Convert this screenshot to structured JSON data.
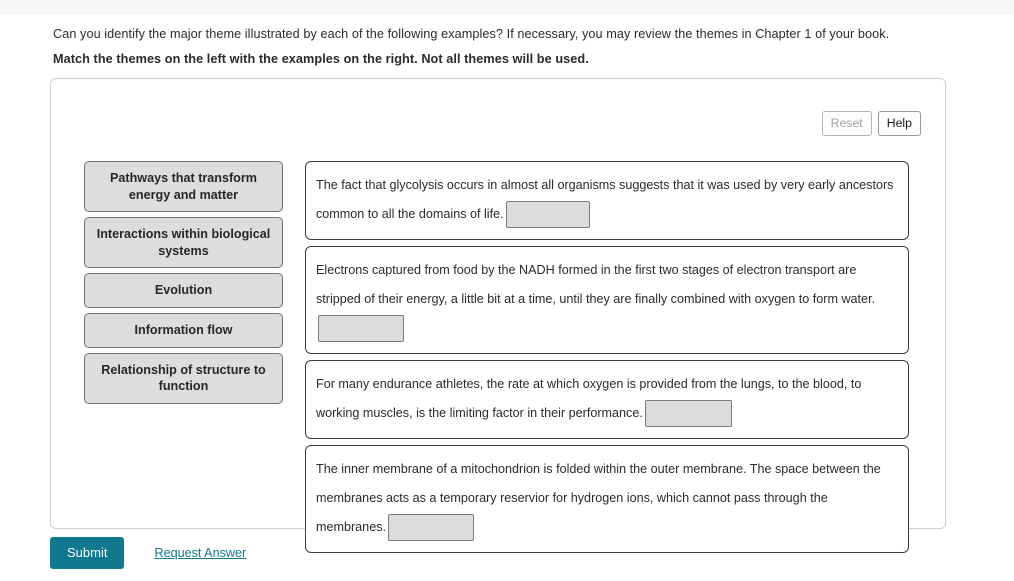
{
  "question": {
    "line1": "Can you identify the major theme illustrated by each of the following examples? If necessary, you may review the themes in Chapter 1 of your book.",
    "line2": "Match the themes on the left with the examples on the right. Not all themes will be used."
  },
  "toolbar": {
    "reset_label": "Reset",
    "help_label": "Help"
  },
  "themes": [
    {
      "label": "Pathways that transform energy and matter"
    },
    {
      "label": "Interactions within biological systems"
    },
    {
      "label": "Evolution"
    },
    {
      "label": "Information flow"
    },
    {
      "label": "Relationship of structure to function"
    }
  ],
  "examples": [
    {
      "text_before": "The fact that glycolysis occurs in almost all organisms suggests that it was used by very early ancestors common to all the domains of life.",
      "slot_value": ""
    },
    {
      "text_before": "Electrons captured from food by the NADH formed in the first two stages of electron transport are stripped of their energy, a little bit at a time, until they are finally combined with oxygen to form water.",
      "slot_value": ""
    },
    {
      "text_before": "For many endurance athletes, the rate at which oxygen is provided from the lungs, to the blood, to working muscles, is the limiting factor in their performance.",
      "slot_value": ""
    },
    {
      "text_before": "The inner membrane of a mitochondrion is folded within the outer membrane. The space between the membranes acts as a temporary reservior for hydrogen ions, which cannot pass through the membranes.",
      "slot_value": ""
    }
  ],
  "footer": {
    "submit_label": "Submit",
    "request_answer_label": "Request Answer"
  },
  "colors": {
    "accent": "#10788f",
    "tile_fill": "#dddddd",
    "slot_fill": "#dcdcdc",
    "panel_border": "#cfcfcf",
    "card_border": "#3d3d44"
  }
}
